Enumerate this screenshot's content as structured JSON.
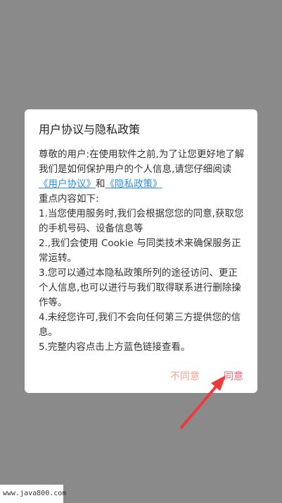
{
  "dialog": {
    "title": "用户协议与隐私政策",
    "intro_prefix": "尊敬的用户:在使用软件之前,为了让您更好地了解我们是如何保护用户的个人信息,请您仔细阅读",
    "user_agreement_link": "《用户协议》",
    "and_text": "和",
    "privacy_policy_link": "《隐私政策》",
    "key_points_heading": "重点内容如下:",
    "points": [
      "1.当您使用服务时,我们会根据您您的同意,获取您的手机号码、设备信息等",
      "2.,我们会使用 Cookie 与同类技术来确保服务正常运转。",
      "3.您可以通过本隐私政策所列的途径访问、更正个人信息,也可以进行与我们取得联系进行删除操作等。",
      "4.未经您许可,我们不会向任何第三方提供您的信息。",
      "5.完整内容点击上方蓝色链接查看。"
    ],
    "disagree_label": "不同意",
    "agree_label": "同意"
  },
  "watermark": "www.java800.com",
  "colors": {
    "overlay": "#8a8a8a",
    "link": "#2b8de3",
    "disagree": "#f7a28f",
    "agree": "#f0627a",
    "arrow": "#f03a3a"
  }
}
